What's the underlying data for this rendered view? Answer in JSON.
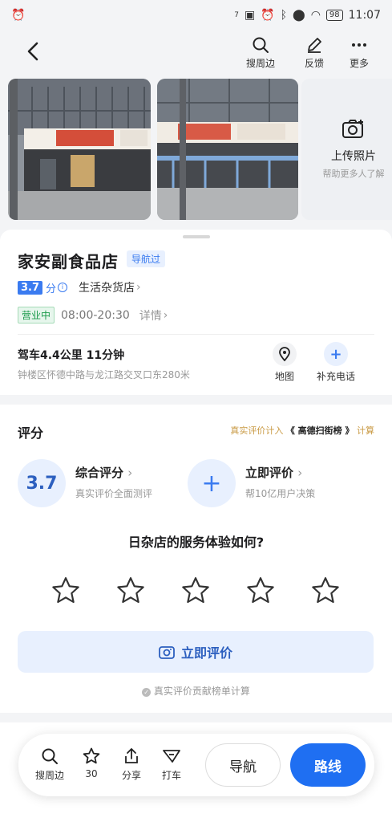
{
  "status_bar": {
    "left_icon": "alarm-icon",
    "time": "11:07",
    "battery": "98",
    "net_speed": "7"
  },
  "top_nav": {
    "back_icon": "chevron-left-icon",
    "actions": [
      {
        "label": "搜周边",
        "icon": "search-icon"
      },
      {
        "label": "反馈",
        "icon": "pen-icon"
      },
      {
        "label": "更多",
        "icon": "more-icon"
      }
    ]
  },
  "photos": {
    "upload_label": "上传照片",
    "upload_hint": "帮助更多人了解"
  },
  "place": {
    "name": "家安副食品店",
    "nav_tag": "导航过",
    "score": "3.7",
    "score_unit": "分",
    "category": "生活杂货店",
    "status": "营业中",
    "hours": "08:00-20:30",
    "detail_link": "详情",
    "distance": "驾车4.4公里 11分钟",
    "address": "钟楼区怀德中路与龙江路交叉口东280米",
    "map_label": "地图",
    "phone_label": "补充电话"
  },
  "rating": {
    "title": "评分",
    "note_prefix": "真实评价计入",
    "note_brand": "《 高德扫街榜 》",
    "note_suffix": "计算",
    "score": "3.7",
    "overall_title": "综合评分",
    "overall_sub": "真实评价全面测评",
    "rate_title": "立即评价",
    "rate_sub": "帮10亿用户决策",
    "question": "日杂店的服务体验如何?",
    "stars_selected": 0,
    "stars_total": 5,
    "button_label": "立即评价",
    "footnote": "真实评价贡献榜单计算"
  },
  "bottom_bar": {
    "actions": [
      {
        "label": "搜周边",
        "icon": "search-icon"
      },
      {
        "label": "30",
        "icon": "star-icon"
      },
      {
        "label": "分享",
        "icon": "share-icon"
      },
      {
        "label": "打车",
        "icon": "taxi-icon"
      }
    ],
    "navigate_label": "导航",
    "route_label": "路线",
    "accent": "#1f6ff2"
  }
}
